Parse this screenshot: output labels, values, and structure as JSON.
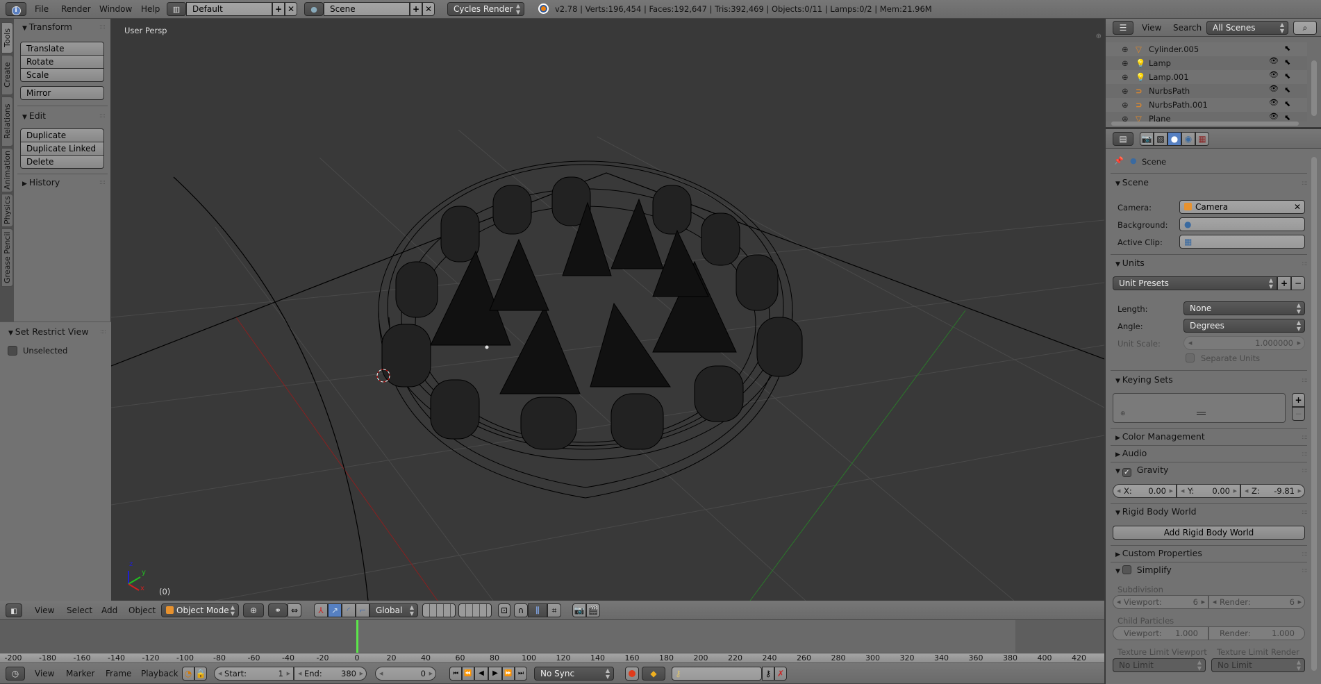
{
  "top_header": {
    "menus": [
      "File",
      "Render",
      "Window",
      "Help"
    ],
    "layout_name": "Default",
    "scene_name": "Scene",
    "render_engine": "Cycles Render",
    "stats": "v2.78 | Verts:196,454 | Faces:192,647 | Tris:392,469 | Objects:0/11 | Lamps:0/2 | Mem:21.96M"
  },
  "tool_shelf": {
    "tabs": [
      "Tools",
      "Create",
      "Relations",
      "Animation",
      "Physics",
      "Grease Pencil"
    ],
    "transform": {
      "title": "Transform",
      "buttons": [
        "Translate",
        "Rotate",
        "Scale"
      ],
      "mirror": "Mirror"
    },
    "edit": {
      "title": "Edit",
      "buttons": [
        "Duplicate",
        "Duplicate Linked",
        "Delete"
      ]
    },
    "history": {
      "title": "History"
    },
    "restrict": {
      "title": "Set Restrict View",
      "checkbox": "Unselected"
    }
  },
  "viewport": {
    "view_label": "User Persp",
    "frame_label": "(0)",
    "axes": {
      "x": "x",
      "y": "y",
      "z": "z"
    }
  },
  "view3d_header": {
    "menus": [
      "View",
      "Select",
      "Add",
      "Object"
    ],
    "mode": "Object Mode",
    "orientation": "Global"
  },
  "timeline": {
    "ticks": [
      "-200",
      "-180",
      "-160",
      "-140",
      "-120",
      "-100",
      "-80",
      "-60",
      "-40",
      "-20",
      "0",
      "20",
      "40",
      "60",
      "80",
      "100",
      "120",
      "140",
      "160",
      "180",
      "200",
      "220",
      "240",
      "260",
      "280",
      "300",
      "320",
      "340",
      "360",
      "380",
      "400",
      "420"
    ],
    "current_frame_marker": 0,
    "menus": [
      "View",
      "Marker",
      "Frame",
      "Playback"
    ],
    "start_label": "Start:",
    "start": "1",
    "end_label": "End:",
    "end": "380",
    "current": "0",
    "sync": "No Sync"
  },
  "outliner": {
    "menus": [
      "View",
      "Search"
    ],
    "filter": "All Scenes",
    "items": [
      {
        "name": "Cylinder.005",
        "type": "mesh"
      },
      {
        "name": "Lamp",
        "type": "lamp"
      },
      {
        "name": "Lamp.001",
        "type": "lamp"
      },
      {
        "name": "NurbsPath",
        "type": "curve"
      },
      {
        "name": "NurbsPath.001",
        "type": "curve"
      },
      {
        "name": "Plane",
        "type": "mesh"
      }
    ]
  },
  "properties": {
    "breadcrumb": "Scene",
    "scene_panel": {
      "title": "Scene",
      "camera_label": "Camera:",
      "camera_value": "Camera",
      "background_label": "Background:",
      "active_clip_label": "Active Clip:"
    },
    "units_panel": {
      "title": "Units",
      "presets": "Unit Presets",
      "length_label": "Length:",
      "length_value": "None",
      "angle_label": "Angle:",
      "angle_value": "Degrees",
      "scale_label": "Unit Scale:",
      "scale_value": "1.000000",
      "separate": "Separate Units"
    },
    "keying_sets": {
      "title": "Keying Sets"
    },
    "color_management": {
      "title": "Color Management"
    },
    "audio": {
      "title": "Audio"
    },
    "gravity": {
      "title": "Gravity",
      "checked": true,
      "x_label": "X:",
      "x": "0.00",
      "y_label": "Y:",
      "y": "0.00",
      "z_label": "Z:",
      "z": "-9.81"
    },
    "rigid_body": {
      "title": "Rigid Body World",
      "button": "Add Rigid Body World"
    },
    "custom_props": {
      "title": "Custom Properties"
    },
    "simplify": {
      "title": "Simplify",
      "checked": false,
      "subdivision": "Subdivision",
      "viewport_label": "Viewport:",
      "viewport": "6",
      "render_label": "Render:",
      "render": "6",
      "child_particles": "Child Particles",
      "cp_viewport": "1.000",
      "cp_render": "1.000",
      "tex_viewport_label": "Texture Limit Viewport",
      "tex_render_label": "Texture Limit Render",
      "tex_viewport": "No Limit",
      "tex_render": "No Limit"
    }
  }
}
